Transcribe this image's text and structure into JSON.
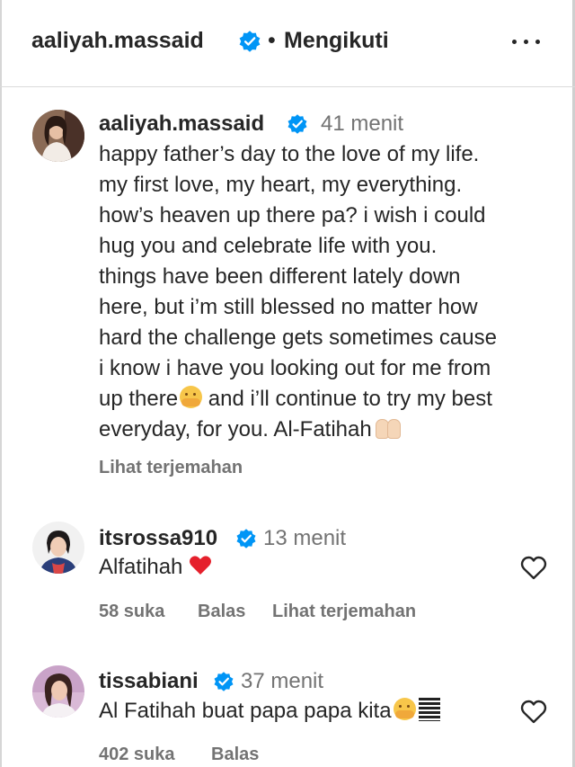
{
  "header": {
    "username": "aaliyah.massaid",
    "dot": "•",
    "follow_status": "Mengikuti"
  },
  "post": {
    "username": "aaliyah.massaid",
    "time": "41 menit",
    "lines": [
      "happy father’s day to the love of my life.",
      "my first love, my heart, my everything.",
      "how’s heaven up there pa? i wish i could",
      "hug you and celebrate life with you.",
      "things have been different lately down",
      "here, but i’m still blessed no matter how",
      "hard the challenge gets sometimes cause",
      "i know i have you looking out for me from",
      "up there",
      " and i’ll continue to try my best",
      "everyday, for you. Al-Fatihah"
    ],
    "translate": "Lihat terjemahan"
  },
  "comments": [
    {
      "username": "itsrossa910",
      "time": "13 menit",
      "text": "Alfatihah",
      "likes": "58 suka",
      "reply": "Balas",
      "translate": "Lihat terjemahan"
    },
    {
      "username": "tissabiani",
      "time": "37 menit",
      "text": "Al Fatihah buat papa papa kita",
      "likes": "402 suka",
      "reply": "Balas"
    }
  ],
  "icons": {
    "verified": "verified-badge-icon",
    "more": "more-options-icon",
    "like": "heart-outline-icon"
  },
  "colors": {
    "verified_blue": "#0095f6",
    "secondary_text": "#737373",
    "primary_text": "#262626"
  }
}
